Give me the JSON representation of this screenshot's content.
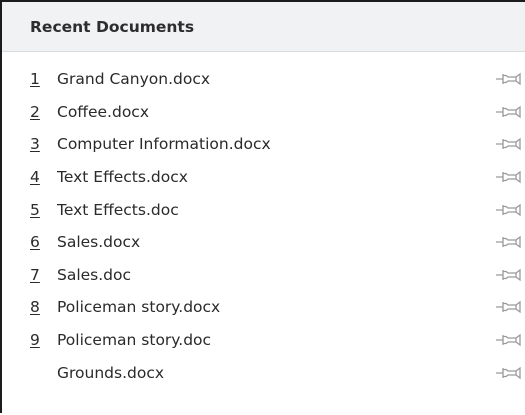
{
  "panel": {
    "title": "Recent Documents"
  },
  "documents": [
    {
      "number": "1",
      "name": "Grand Canyon.docx",
      "icon": "pin-icon"
    },
    {
      "number": "2",
      "name": "Coffee.docx",
      "icon": "pin-icon"
    },
    {
      "number": "3",
      "name": "Computer Information.docx",
      "icon": "pin-icon"
    },
    {
      "number": "4",
      "name": "Text Effects.docx",
      "icon": "pin-icon"
    },
    {
      "number": "5",
      "name": "Text Effects.doc",
      "icon": "pin-icon"
    },
    {
      "number": "6",
      "name": "Sales.docx",
      "icon": "pin-icon"
    },
    {
      "number": "7",
      "name": "Sales.doc",
      "icon": "pin-icon"
    },
    {
      "number": "8",
      "name": "Policeman story.docx",
      "icon": "pin-icon"
    },
    {
      "number": "9",
      "name": "Policeman story.doc",
      "icon": "pin-icon"
    },
    {
      "number": "",
      "name": "Grounds.docx",
      "icon": "pin-icon"
    }
  ],
  "colors": {
    "header_bg": "#f1f2f4",
    "border": "#1c1c1c",
    "text": "#2a2a2a",
    "pin": "#9a9a9a"
  }
}
